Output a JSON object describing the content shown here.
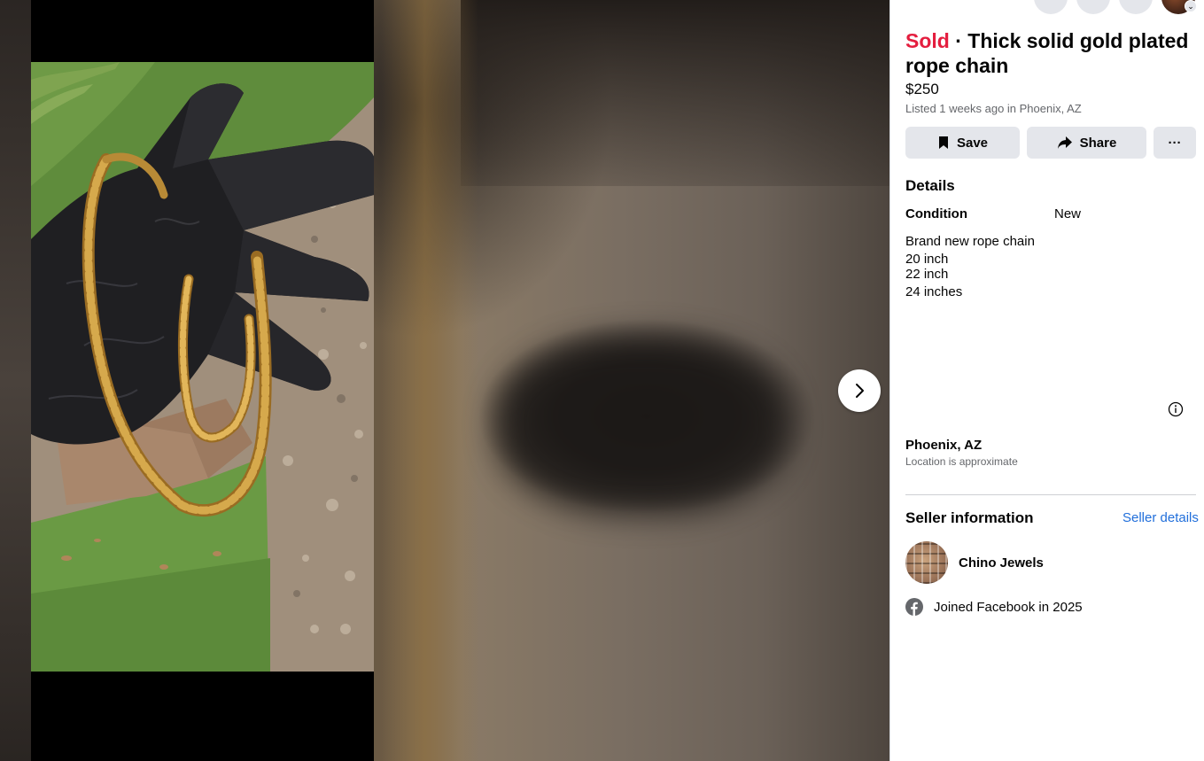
{
  "listing": {
    "status": "Sold",
    "separator": " · ",
    "title": "Thick solid gold plated rope chain",
    "price": "$250",
    "listed": "Listed 1 weeks ago in Phoenix, AZ"
  },
  "actions": {
    "save_label": "Save",
    "share_label": "Share",
    "more_label": "···"
  },
  "details": {
    "heading": "Details",
    "condition_label": "Condition",
    "condition_value": "New",
    "description": [
      "Brand new rope chain",
      "20 inch",
      "22 inch",
      "24 inches"
    ]
  },
  "location": {
    "city": "Phoenix, AZ",
    "note": "Location is approximate"
  },
  "seller": {
    "heading": "Seller information",
    "details_link": "Seller details",
    "name": "Chino Jewels",
    "joined": "Joined Facebook in 2025"
  },
  "colors": {
    "sold": "#e41e3f",
    "link": "#216fdb",
    "button_bg": "#e4e6eb",
    "secondary_text": "#65676b"
  },
  "icons": [
    "bookmark-icon",
    "share-arrow-icon",
    "more-icon",
    "chevron-right-icon",
    "info-icon",
    "facebook-icon"
  ]
}
